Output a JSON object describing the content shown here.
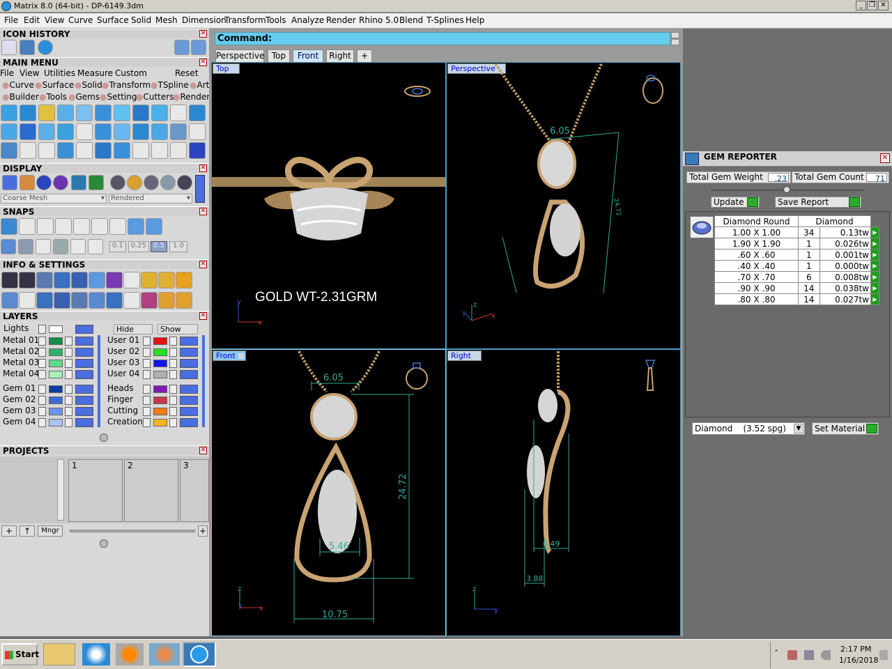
{
  "app": {
    "title": "Matrix 8.0 (64-bit) - DP-6149.3dm"
  },
  "menu": [
    "File",
    "Edit",
    "View",
    "Curve",
    "Surface",
    "Solid",
    "Mesh",
    "Dimension",
    "Transform",
    "Tools",
    "Analyze",
    "Render",
    "Rhino 5.0",
    "Blend",
    "T-Splines",
    "Help"
  ],
  "panels": {
    "icon_history": "ICON HISTORY",
    "main_menu": "MAIN MENU",
    "display": "DISPLAY",
    "snaps": "SNAPS",
    "info_settings": "INFO & SETTINGS",
    "layers": "LAYERS",
    "projects": "PROJECTS"
  },
  "main_menu": {
    "row1": [
      "File",
      "View",
      "Utilities",
      "Measure",
      "Custom",
      "Reset"
    ],
    "row2": [
      "Curve",
      "Surface",
      "Solid",
      "Transform",
      "TSpline",
      "Art"
    ],
    "row3": [
      "Builder",
      "Tools",
      "Gems",
      "Setting",
      "Cutters",
      "Render"
    ]
  },
  "display": {
    "mesh": "Coarse Mesh",
    "mode": "Rendered"
  },
  "snaps": {
    "values": [
      "0.1",
      "0.25",
      "0.5",
      "1.0"
    ]
  },
  "layers": {
    "lights": "Lights",
    "hide": "Hide",
    "show": "Show",
    "left": [
      "Metal 01",
      "Metal 02",
      "Metal 03",
      "Metal 04",
      "Gem 01",
      "Gem 02",
      "Gem 03",
      "Gem 04"
    ],
    "right": [
      "User 01",
      "User 02",
      "User 03",
      "User 04",
      "Heads",
      "Finger",
      "Cutting",
      "Creation"
    ],
    "left_colors": [
      "#1a8a4a",
      "#2fb06a",
      "#5ed98a",
      "#a6f0bb",
      "#0d3c9e",
      "#3d6cd0",
      "#6a96e8",
      "#a9c4f5"
    ],
    "right_colors": [
      "#e01414",
      "#22e022",
      "#1414e8",
      "#b0b0b0",
      "#7e1ab8",
      "#c23a48",
      "#f07a14",
      "#f5b41e"
    ]
  },
  "projects": {
    "slots": [
      "1",
      "2",
      "3"
    ],
    "mngr": "Mngr"
  },
  "command": {
    "label": "Command:"
  },
  "tabs": [
    "Perspective",
    "Top",
    "Front",
    "Right",
    "+"
  ],
  "viewports": {
    "top": {
      "label": "Top",
      "annotation": "GOLD WT-2.31GRM"
    },
    "perspective": {
      "label": "Perspective",
      "dims": [
        "6.05",
        "24.72"
      ]
    },
    "front": {
      "label": "Front",
      "dims": [
        "6.05",
        "24.72",
        "5.46",
        "10.75"
      ]
    },
    "right": {
      "label": "Right",
      "dims": [
        "6.49",
        "3.88"
      ]
    }
  },
  "gem_reporter": {
    "title": "GEM REPORTER",
    "weight_label": "Total Gem Weight",
    "weight": ".23",
    "count_label": "Total Gem Count",
    "count": "71",
    "update": "Update",
    "save": "Save Report",
    "col1": "Diamond Round",
    "col2": "Diamond",
    "rows": [
      {
        "size": "1.00 X 1.00",
        "qty": "34",
        "wt": "0.13tw"
      },
      {
        "size": "1.90 X 1.90",
        "qty": "1",
        "wt": "0.026tw"
      },
      {
        "size": ".60 X .60",
        "qty": "1",
        "wt": "0.001tw"
      },
      {
        "size": ".40 X .40",
        "qty": "1",
        "wt": "0.000tw"
      },
      {
        "size": ".70 X .70",
        "qty": "6",
        "wt": "0.008tw"
      },
      {
        "size": ".90 X .90",
        "qty": "14",
        "wt": "0.038tw"
      },
      {
        "size": ".80 X .80",
        "qty": "14",
        "wt": "0.027tw"
      }
    ],
    "material": "Diamond    (3.52 spg)",
    "set_material": "Set Material"
  },
  "taskbar": {
    "start": "Start",
    "time": "2:17 PM",
    "date": "1/16/2018"
  }
}
